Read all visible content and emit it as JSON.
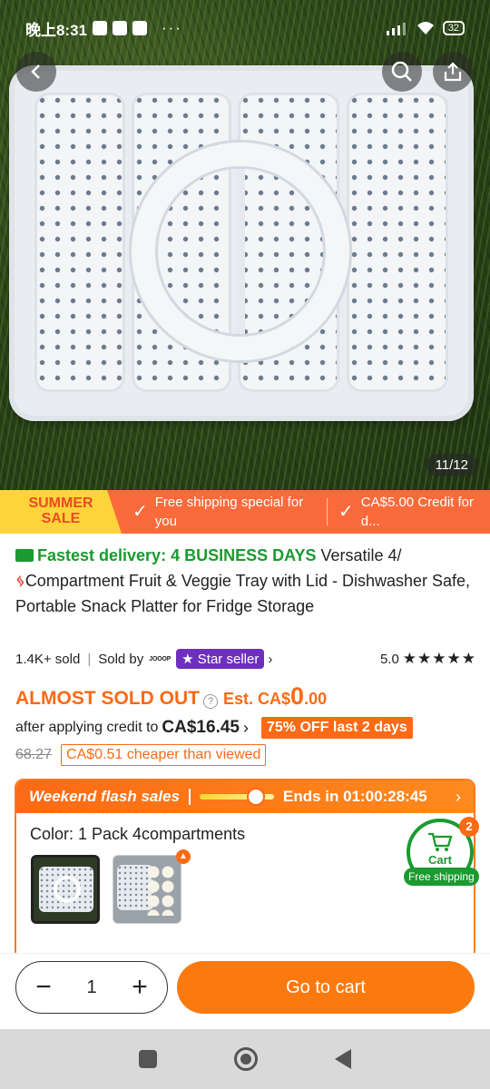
{
  "status_bar": {
    "time": "晚上8:31",
    "battery": "32"
  },
  "hero": {
    "image_counter": "11/12"
  },
  "promo": {
    "summer_line1": "SUMMER",
    "summer_line2": "SALE",
    "item1": "Free shipping special for you",
    "item2": "CA$5.00 Credit for d..."
  },
  "product": {
    "delivery": "Fastest delivery: 4 BUSINESS DAYS",
    "title_part1": " Versatile 4/",
    "title_part2": "Compartment Fruit & Veggie Tray with Lid - Dishwasher Safe, Portable Snack Platter for Fridge Storage",
    "sold": "1.4K+ sold",
    "sold_by": "Sold by",
    "seller_logo": "JOOOP",
    "star_seller": "Star seller",
    "rating": "5.0",
    "stars": "★★★★★"
  },
  "pricing": {
    "almost_sold_out": "ALMOST SOLD OUT",
    "est_prefix": "Est. CA$",
    "est_big": "0",
    "est_decimal": ".00",
    "after_credit": "after applying credit to",
    "credit_amount": "CA$16.45",
    "off_badge": "75% OFF last 2 days",
    "original": "68.27",
    "cheaper": "CA$0.51 cheaper than viewed"
  },
  "flash": {
    "title": "Weekend flash sales",
    "progress": 0.75,
    "ends": "Ends in 01:00:28:45",
    "color_label": "Color: 1 Pack 4compartments"
  },
  "cart": {
    "label": "Cart",
    "count": "2",
    "free_shipping": "Free shipping"
  },
  "action": {
    "quantity": "1",
    "goto_cart": "Go to cart"
  },
  "colors": {
    "accent": "#fb6a15",
    "green": "#1a9a2f",
    "purple": "#6e2fbf"
  }
}
